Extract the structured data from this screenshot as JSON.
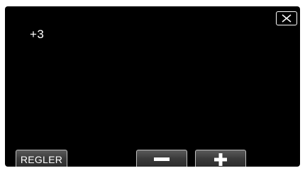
{
  "screen": {
    "value": "+3"
  },
  "buttons": {
    "close_icon": "close-icon",
    "regler_label": "REGLER",
    "minus_icon": "minus-icon",
    "plus_icon": "plus-icon"
  },
  "colors": {
    "background": "#000000",
    "text": "#ffffff",
    "button_border": "#bfbfbf"
  }
}
